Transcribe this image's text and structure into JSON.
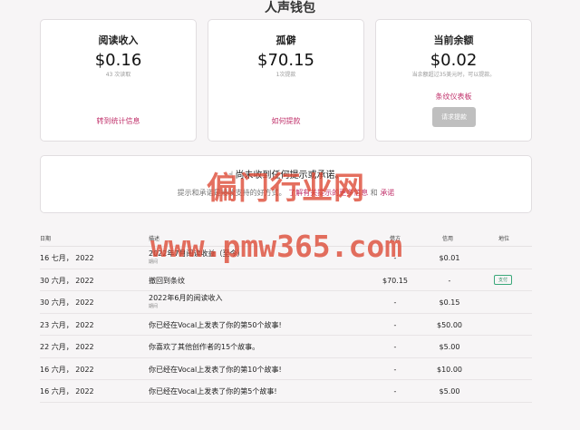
{
  "page": {
    "title": "人声钱包"
  },
  "cards": [
    {
      "title": "阅读收入",
      "value": "$0.16",
      "sub": "43 次读取",
      "link": "转到统计信息"
    },
    {
      "title": "孤僻",
      "value": "$70.15",
      "sub": "1次提款",
      "link": "如何提款"
    },
    {
      "title": "当前余额",
      "value": "$0.02",
      "sub": "当余额超过35美元时，可以提款。",
      "link": "条纹仪表板",
      "button": "请求提款"
    }
  ],
  "notice": {
    "icon": "hand-icon",
    "heading": "尚未收到任何提示或承诺。",
    "body_prefix": "提示和承诺是接收支持的好方式。",
    "link1": "了解有关提示的更多信息",
    "join": " 和 ",
    "link2": "承诺"
  },
  "table": {
    "headers": {
      "date": "日期",
      "desc": "描述",
      "debit": "借方",
      "credit": "信用",
      "status": "地位"
    },
    "rows": [
      {
        "date": "16 七月， 2022",
        "desc": "2022年7月阅读收益（至今）",
        "note": "期间",
        "debit": "-",
        "credit": "$0.01",
        "status": ""
      },
      {
        "date": "30 六月， 2022",
        "desc": "撤回到条纹",
        "note": "",
        "debit": "$70.15",
        "credit": "-",
        "status": "支付"
      },
      {
        "date": "30 六月， 2022",
        "desc": "2022年6月的阅读收入",
        "note": "期间",
        "debit": "-",
        "credit": "$0.15",
        "status": ""
      },
      {
        "date": "23 六月， 2022",
        "desc": "你已经在Vocal上发表了你的第50个故事!",
        "note": "",
        "debit": "-",
        "credit": "$50.00",
        "status": ""
      },
      {
        "date": "22 六月， 2022",
        "desc": "你喜欢了其他创作者的15个故事。",
        "note": "",
        "debit": "-",
        "credit": "$5.00",
        "status": ""
      },
      {
        "date": "16 六月， 2022",
        "desc": "你已经在Vocal上发表了你的第10个故事!",
        "note": "",
        "debit": "-",
        "credit": "$10.00",
        "status": ""
      },
      {
        "date": "16 六月， 2022",
        "desc": "你已经在Vocal上发表了你的第5个故事!",
        "note": "",
        "debit": "-",
        "credit": "$5.00",
        "status": ""
      }
    ]
  },
  "watermark": {
    "line1": "偏门行业网",
    "line2": "www.pmw365.com"
  },
  "colors": {
    "accent": "#c0306a",
    "paid": "#2f8f66",
    "watermark": "#dc4632"
  }
}
